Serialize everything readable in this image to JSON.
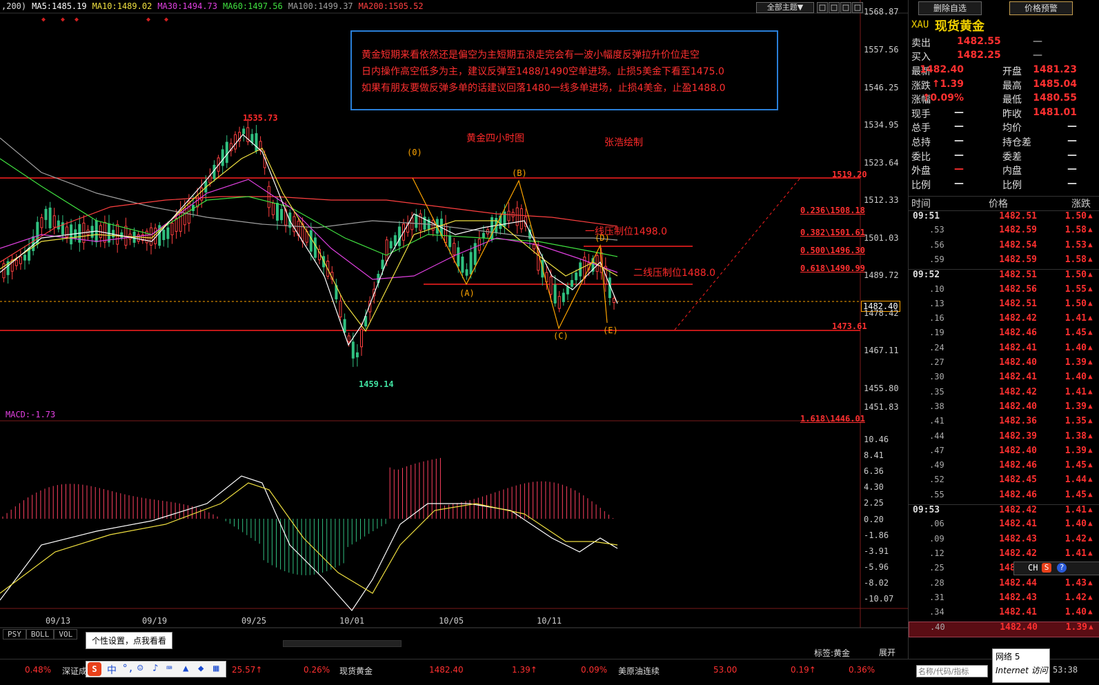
{
  "ma_legend": [
    {
      "label": ",200)",
      "color": "#dddddd"
    },
    {
      "label": "MA5:1485.19",
      "color": "#ffffff"
    },
    {
      "label": "MA10:1489.02",
      "color": "#f0e040"
    },
    {
      "label": "MA30:1494.73",
      "color": "#e040e0"
    },
    {
      "label": "MA60:1497.56",
      "color": "#40e040"
    },
    {
      "label": "MA100:1499.37",
      "color": "#a0a0a0"
    },
    {
      "label": "MA200:1505.52",
      "color": "#ff4040"
    }
  ],
  "toolbar": {
    "theme_label": "全部主题▼"
  },
  "annotation": {
    "lines": [
      "黄金短期来看依然还是偏空为主短期五浪走完会有一波小幅度反弹拉升价位走空",
      "日内操作高空低多为主，建议反弹至1488/1490空单进场。止损5美金下看至1475.0",
      " 如果有朋友要做反弹多单的话建议回落1480一线多单进场，止损4美金，止盈1488.0"
    ],
    "chart_title": "黄金四小时图",
    "author": "张浩绘制",
    "resistance1": "一线压制位1498.0",
    "resistance2": "二线压制位1488.0",
    "high_label": "1535.73",
    "low_label": "1459.14",
    "waves": [
      "(0)",
      "(B)",
      "(A)",
      "(D)",
      "(C)",
      "(E)"
    ]
  },
  "fib_labels": [
    "0.236\\1508.18",
    "0.382\\1501.61",
    "0.500\\1496.30",
    "0.618\\1490.99",
    "1.618\\1446.01"
  ],
  "line_labels": {
    "top": "1519.20",
    "bottom": "1473.61",
    "current": "1482.40"
  },
  "price_axis": [
    "1568.87",
    "1557.56",
    "1546.25",
    "1534.95",
    "1523.64",
    "1512.33",
    "1501.03",
    "1489.72",
    "1478.42",
    "1467.11",
    "1455.80",
    "1451.83"
  ],
  "macd": {
    "legend": "MACD:-1.73",
    "axis": [
      "10.46",
      "8.41",
      "6.36",
      "4.30",
      "2.25",
      "0.20",
      "-1.86",
      "-3.91",
      "-5.96",
      "-8.02",
      "-10.07"
    ]
  },
  "x_axis": [
    "09/13",
    "09/19",
    "09/25",
    "10/01",
    "10/05",
    "10/11"
  ],
  "indicator_tabs": [
    "PSY",
    "BOLL",
    "VOL"
  ],
  "tooltip": "个性设置，点我看看",
  "right_panel": {
    "btn_remove": "删除自选",
    "btn_alert": "价格预警",
    "symbol": "XAU",
    "name": "现货黄金",
    "sell_label": "卖出",
    "sell": "1482.55",
    "buy_label": "买入",
    "buy": "1482.25",
    "dash": "—",
    "quote": [
      [
        "最新",
        "1482.40",
        "开盘",
        "1481.23"
      ],
      [
        "涨跌",
        "↑1.39",
        "最高",
        "1485.04"
      ],
      [
        "涨幅",
        "↑0.09%",
        "最低",
        "1480.55"
      ],
      [
        "现手",
        "—",
        "昨收",
        "1481.01"
      ],
      [
        "总手",
        "—",
        "均价",
        "—"
      ],
      [
        "总持",
        "—",
        "持仓差",
        "—"
      ],
      [
        "委比",
        "—",
        "委差",
        "—"
      ],
      [
        "外盘",
        "—",
        "内盘",
        "—"
      ],
      [
        "比例",
        "—",
        "比例",
        "—"
      ]
    ],
    "tick_header": [
      "时间",
      "价格",
      "涨跌"
    ],
    "ticks": [
      [
        "09:51",
        "1482.51",
        "1.50"
      ],
      [
        ".53",
        "1482.59",
        "1.58"
      ],
      [
        ".56",
        "1482.54",
        "1.53"
      ],
      [
        ".59",
        "1482.59",
        "1.58"
      ],
      [
        "09:52",
        "1482.51",
        "1.50"
      ],
      [
        ".10",
        "1482.56",
        "1.55"
      ],
      [
        ".13",
        "1482.51",
        "1.50"
      ],
      [
        ".16",
        "1482.42",
        "1.41"
      ],
      [
        ".19",
        "1482.46",
        "1.45"
      ],
      [
        ".24",
        "1482.41",
        "1.40"
      ],
      [
        ".27",
        "1482.40",
        "1.39"
      ],
      [
        ".30",
        "1482.41",
        "1.40"
      ],
      [
        ".35",
        "1482.42",
        "1.41"
      ],
      [
        ".38",
        "1482.40",
        "1.39"
      ],
      [
        ".41",
        "1482.36",
        "1.35"
      ],
      [
        ".44",
        "1482.39",
        "1.38"
      ],
      [
        ".47",
        "1482.40",
        "1.39"
      ],
      [
        ".49",
        "1482.46",
        "1.45"
      ],
      [
        ".52",
        "1482.45",
        "1.44"
      ],
      [
        ".55",
        "1482.46",
        "1.45"
      ],
      [
        "09:53",
        "1482.42",
        "1.41"
      ],
      [
        ".06",
        "1482.41",
        "1.40"
      ],
      [
        ".09",
        "1482.43",
        "1.42"
      ],
      [
        ".12",
        "1482.42",
        "1.41"
      ],
      [
        ".25",
        "1482.54",
        "1.53"
      ],
      [
        ".28",
        "1482.44",
        "1.43"
      ],
      [
        ".31",
        "1482.43",
        "1.42"
      ],
      [
        ".34",
        "1482.41",
        "1.40"
      ],
      [
        ".40",
        "1482.40",
        "1.39"
      ]
    ],
    "ime": "CH"
  },
  "bottom": {
    "tag_label": "标签:黄金",
    "expand": "展开",
    "search_placeholder": "名称/代码/指标",
    "network": "网络 5",
    "ie": "Internet 访问",
    "time": "53:38",
    "ticker": [
      {
        "t": "0.48%",
        "c": "#ff3030"
      },
      {
        "t": "深证成",
        "c": "#dddddd"
      },
      {
        "t": "25.57↑",
        "c": "#ff3030"
      },
      {
        "t": "0.26%",
        "c": "#ff3030"
      },
      {
        "t": "现货黄金",
        "c": "#dddddd"
      },
      {
        "t": "1482.40",
        "c": "#ff3030"
      },
      {
        "t": "1.39↑",
        "c": "#ff3030"
      },
      {
        "t": "0.09%",
        "c": "#ff3030"
      },
      {
        "t": "美原油连续",
        "c": "#dddddd"
      },
      {
        "t": "53.00",
        "c": "#ff3030"
      },
      {
        "t": "0.19↑",
        "c": "#ff3030"
      },
      {
        "t": "0.36%",
        "c": "#ff3030"
      }
    ]
  }
}
